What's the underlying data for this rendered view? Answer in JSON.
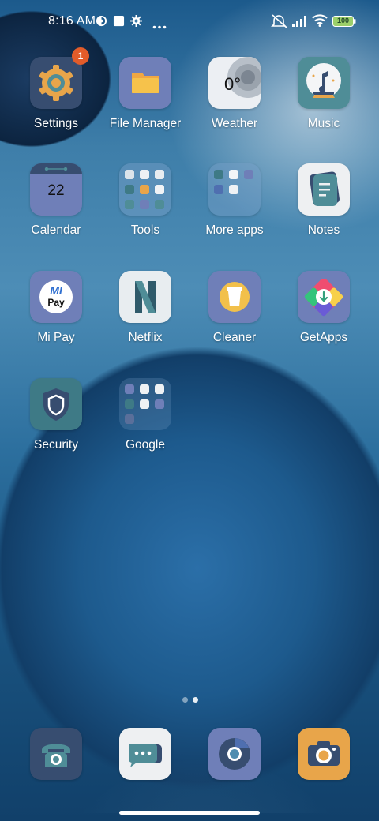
{
  "status_bar": {
    "time": "8:16 AM",
    "battery": "100",
    "icons": [
      "app-notification-icon",
      "square-notification-icon",
      "gear-icon",
      "more-icon",
      "mute-icon",
      "signal-icon",
      "wifi-icon",
      "battery-icon"
    ]
  },
  "apps": [
    {
      "label": "Settings",
      "icon": "settings-icon",
      "badge": "1",
      "color": "#374d70"
    },
    {
      "label": "File Manager",
      "icon": "folder-icon",
      "color": "#6f7fb8"
    },
    {
      "label": "Weather",
      "icon": "weather-icon",
      "temp": "0°",
      "color": "#eceff3"
    },
    {
      "label": "Music",
      "icon": "music-icon",
      "color": "#4f8d97"
    },
    {
      "label": "Calendar",
      "icon": "calendar-icon",
      "date": "22",
      "color": "#6f7fb8"
    },
    {
      "label": "Tools",
      "icon": "tools-folder-icon"
    },
    {
      "label": "More apps",
      "icon": "more-apps-folder-icon"
    },
    {
      "label": "Notes",
      "icon": "notes-icon",
      "color": "#eef0f2"
    },
    {
      "label": "Mi Pay",
      "icon": "mi-pay-icon",
      "color": "#6f7fb8"
    },
    {
      "label": "Netflix",
      "icon": "netflix-icon",
      "color": "#e8edf0"
    },
    {
      "label": "Cleaner",
      "icon": "cleaner-icon",
      "color": "#6f7fb8"
    },
    {
      "label": "GetApps",
      "icon": "getapps-icon",
      "color": "#6f7fb8"
    },
    {
      "label": "Security",
      "icon": "shield-icon",
      "color": "#3e7a86"
    },
    {
      "label": "Google",
      "icon": "google-folder-icon"
    }
  ],
  "mi_pay_text": {
    "top": "MI",
    "bottom": "Pay"
  },
  "netflix_letter": "N",
  "dock": [
    {
      "name": "phone",
      "icon": "phone-icon"
    },
    {
      "name": "messages",
      "icon": "messages-icon"
    },
    {
      "name": "browser",
      "icon": "browser-icon"
    },
    {
      "name": "camera",
      "icon": "camera-icon"
    }
  ],
  "page_indicator": {
    "pages": 2,
    "current": 2
  },
  "colors": {
    "accent_orange": "#e8a54a",
    "badge": "#e25c2a",
    "slate_blue": "#6f7fb8",
    "navy": "#374d70",
    "teal": "#4f8d97"
  }
}
